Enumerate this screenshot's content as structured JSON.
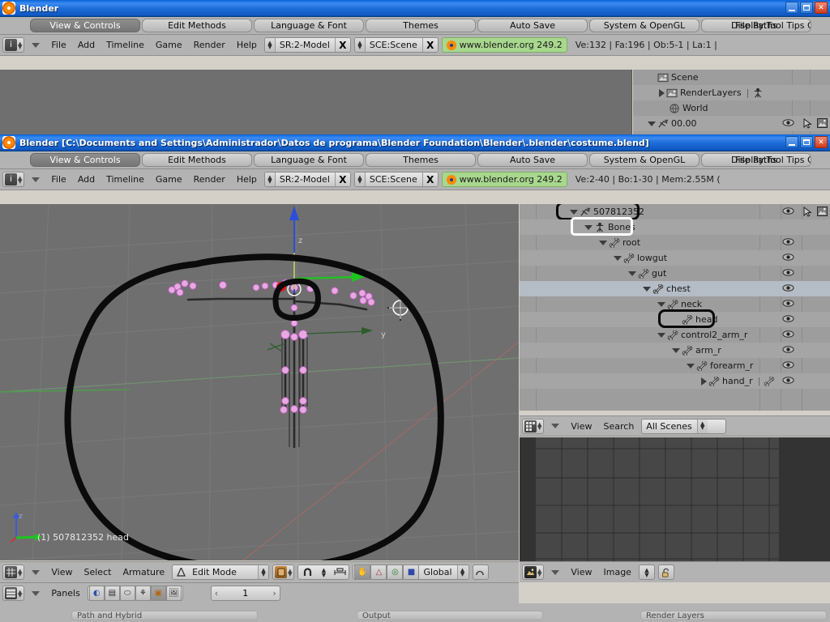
{
  "windows": {
    "back": {
      "title": "Blender",
      "title_icon": "blender-logo-icon",
      "buttons": {
        "minimize": "minimize-icon",
        "maximize": "maximize-icon",
        "close": "close-icon"
      }
    },
    "front": {
      "title": "Blender [C:\\Documents and Settings\\Administrador\\Datos de programa\\Blender Foundation\\Blender\\.blender\\costume.blend]",
      "title_icon": "blender-logo-icon",
      "buttons": {
        "minimize": "minimize-icon",
        "maximize": "maximize-icon",
        "close": "close-icon"
      }
    }
  },
  "prefs_tabs": [
    {
      "label": "View & Controls",
      "active": true
    },
    {
      "label": "Edit Methods",
      "active": false
    },
    {
      "label": "Language & Font",
      "active": false
    },
    {
      "label": "Themes",
      "active": false
    },
    {
      "label": "Auto Save",
      "active": false
    },
    {
      "label": "System & OpenGL",
      "active": false
    },
    {
      "label": "File Paths",
      "active": false
    }
  ],
  "prefs_overlay_text": "Display:Tool Tips O",
  "header": {
    "editor_icon": "info-editor-icon",
    "collapse_icon": "chevron-down-icon",
    "menus": [
      "File",
      "Add",
      "Timeline",
      "Game",
      "Render",
      "Help"
    ],
    "screen_field": {
      "value": "SR:2-Model",
      "clear": "X"
    },
    "scene_field": {
      "value": "SCE:Scene",
      "clear": "X"
    },
    "version_badge": "www.blender.org 249.2",
    "stats_back": "Ve:132 | Fa:196 | Ob:5-1 | La:1 |",
    "stats_front": "Ve:2-40 | Bo:1-30 | Mem:2.55M ("
  },
  "outliner_back": {
    "rows": [
      {
        "indent": 0,
        "arrow": "none",
        "icon": "scene-icon",
        "label": "Scene"
      },
      {
        "indent": 1,
        "arrow": "closed",
        "icon": "image-icon",
        "label": "RenderLayers",
        "extra": "renderlayer-icon"
      },
      {
        "indent": 1,
        "arrow": "none",
        "icon": "world-icon",
        "label": "World"
      },
      {
        "indent": 0,
        "arrow": "open",
        "icon": "armature-icon",
        "label": "00.00",
        "eye": true,
        "cursor": true,
        "render": true
      }
    ]
  },
  "outliner_front": {
    "rows": [
      {
        "indent": 0,
        "arrow": "open",
        "icon": "armature-object-icon",
        "label": "507812352",
        "highlight": "black",
        "eye": true,
        "cursor": true,
        "render": true
      },
      {
        "indent": 1,
        "arrow": "open",
        "icon": "armature-data-icon",
        "label": "Bones",
        "highlight": "white"
      },
      {
        "indent": 2,
        "arrow": "open",
        "icon": "bone-icon",
        "label": "root",
        "eye": true
      },
      {
        "indent": 3,
        "arrow": "open",
        "icon": "bone-icon",
        "label": "lowgut",
        "eye": true
      },
      {
        "indent": 4,
        "arrow": "open",
        "icon": "bone-icon",
        "label": "gut",
        "eye": true
      },
      {
        "indent": 5,
        "arrow": "open",
        "icon": "bone-icon",
        "label": "chest",
        "eye": true,
        "sel": true
      },
      {
        "indent": 6,
        "arrow": "open",
        "icon": "bone-icon",
        "label": "neck",
        "eye": true
      },
      {
        "indent": 7,
        "arrow": "none",
        "icon": "bone-icon",
        "label": "head",
        "eye": true,
        "highlight": "black"
      },
      {
        "indent": 6,
        "arrow": "open",
        "icon": "bone-icon",
        "label": "control2_arm_r",
        "eye": true
      },
      {
        "indent": 7,
        "arrow": "open",
        "icon": "bone-icon",
        "label": "arm_r",
        "eye": true
      },
      {
        "indent": 8,
        "arrow": "open",
        "icon": "bone-icon",
        "label": "forearm_r",
        "eye": true
      },
      {
        "indent": 9,
        "arrow": "closed",
        "icon": "bone-icon",
        "label": "hand_r",
        "eye": true,
        "trailing": "bone-icon"
      }
    ]
  },
  "outliner_footer": {
    "editor_icon": "outliner-editor-icon",
    "collapse_icon": "chevron-down-icon",
    "menus": [
      "View",
      "Search"
    ],
    "scope": "All Scenes"
  },
  "viewport": {
    "axis_gizmo": {
      "label": "z"
    },
    "status_text": "(1) 507812352 head",
    "axis_label_z": "z",
    "axis_label_y": "y",
    "annotation": "hand-drawn black outline around figure and head bone"
  },
  "viewport_header": {
    "editor_icon": "3dview-editor-icon",
    "collapse_icon": "chevron-down-icon",
    "menus": [
      "View",
      "Select",
      "Armature"
    ],
    "mode": {
      "icon": "edit-mode-icon",
      "value": "Edit Mode"
    },
    "draw_type_icon": "draw-type-icon",
    "snap_icon": "snap-magnet-icon",
    "proportional_icon": "proportional-edit-icon",
    "manipulator_icons": [
      "translate-manipulator-icon",
      "rotate-manipulator-icon",
      "scale-manipulator-icon"
    ],
    "orientation": "Global",
    "render_icon": "render-preview-icon"
  },
  "buttons_header": {
    "editor_icon": "buttons-editor-icon",
    "collapse_icon": "chevron-down-icon",
    "label": "Panels",
    "panel_icons": [
      "shading-icon",
      "object-icon",
      "physics-icon",
      "object-data-icon",
      "editing-icon",
      "scene-icon"
    ],
    "frame_value": "1",
    "frame_prev": "prev-frame-icon",
    "frame_next": "next-frame-icon"
  },
  "image_header": {
    "editor_icon": "uv-image-editor-icon",
    "collapse_icon": "chevron-down-icon",
    "menus": [
      "View",
      "Image"
    ],
    "select_icon": "image-browse-icon",
    "lock_icon": "unlock-icon"
  },
  "panel_stubs": [
    "Path and Hybrid",
    "Output",
    "Render Layers"
  ],
  "colors": {
    "title_blue": "#1c74e8",
    "ui_gray": "#b3b3b3",
    "outliner_gray": "#9d9d9d",
    "viewport_gray": "#6f6f6f",
    "version_green": "#a8d78e",
    "highlight_black": "#0a0a0a",
    "highlight_white": "#ffffff",
    "bone_pink": "#e8a8e0",
    "selected_red": "#ee1111",
    "image_editor_dark": "#333333"
  }
}
